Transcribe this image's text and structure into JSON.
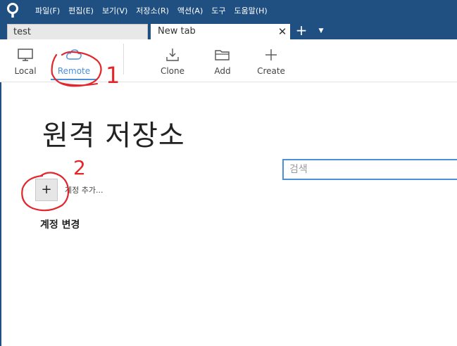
{
  "menu": {
    "items": [
      "파일(F)",
      "편집(E)",
      "보기(V)",
      "저장소(R)",
      "액션(A)",
      "도구",
      "도움말(H)"
    ]
  },
  "tabs": [
    {
      "label": "test",
      "active": false
    },
    {
      "label": "New tab",
      "active": true,
      "close_glyph": "✕"
    }
  ],
  "tab_controls": {
    "add_glyph": "+",
    "dropdown_glyph": "▼"
  },
  "toolbar": {
    "local_label": "Local",
    "remote_label": "Remote",
    "clone_label": "Clone",
    "add_label": "Add",
    "create_label": "Create"
  },
  "main": {
    "title": "원격 저장소",
    "search_placeholder": "검색",
    "add_account_glyph": "+",
    "add_account_label": "계정 추가...",
    "change_account_label": "계정 변경"
  },
  "annotations": {
    "mark_1": "1",
    "mark_2": "2"
  },
  "colors": {
    "brand": "#205081",
    "accent": "#4a90d9",
    "annotation": "#e3262b"
  },
  "icons": {
    "app": "sourcetree-logo-icon",
    "local": "monitor-icon",
    "remote": "cloud-icon",
    "clone": "download-icon",
    "add": "folder-icon",
    "create": "plus-icon"
  }
}
